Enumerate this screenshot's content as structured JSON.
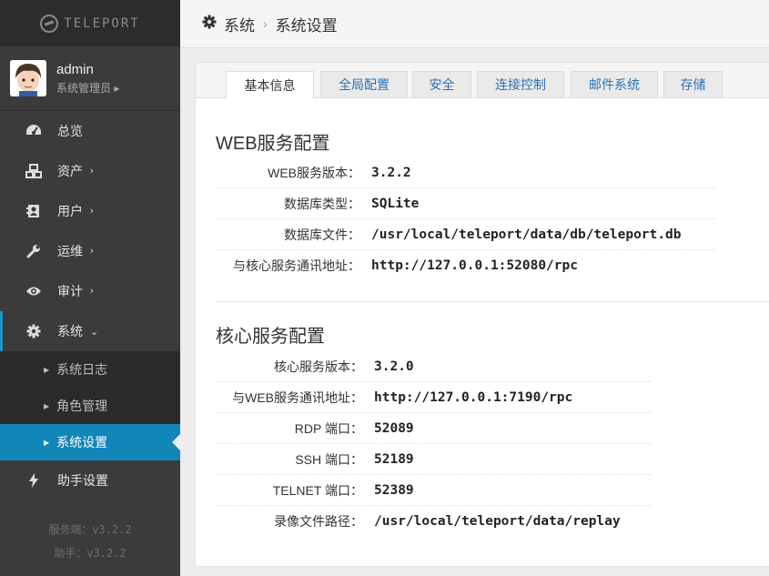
{
  "brand": {
    "name": "TELEPORT"
  },
  "user": {
    "name": "admin",
    "role": "系统管理员 ▸"
  },
  "nav": [
    {
      "label": "总览",
      "icon": "dashboard-icon",
      "chevron": ""
    },
    {
      "label": "资产",
      "icon": "cubes-icon",
      "chevron": "›"
    },
    {
      "label": "用户",
      "icon": "address-card-icon",
      "chevron": "›"
    },
    {
      "label": "运维",
      "icon": "wrench-icon",
      "chevron": "›"
    },
    {
      "label": "审计",
      "icon": "eye-icon",
      "chevron": "›"
    },
    {
      "label": "系统",
      "icon": "gear-icon",
      "chevron": "⌄"
    }
  ],
  "subnav": [
    {
      "label": "系统日志",
      "marker": "▶"
    },
    {
      "label": "角色管理",
      "marker": "▶"
    },
    {
      "label": "系统设置",
      "marker": "▶"
    }
  ],
  "nav_bottom": {
    "label": "助手设置",
    "icon": "bolt-icon"
  },
  "versions": {
    "server": "服务端：v3.2.2",
    "assist": "助手：v3.2.2"
  },
  "breadcrumb": {
    "root": "系统",
    "sep": "›",
    "current": "系统设置"
  },
  "tabs": [
    "基本信息",
    "全局配置",
    "安全",
    "连接控制",
    "邮件系统",
    "存储"
  ],
  "active_tab": 0,
  "web_section": {
    "title": "WEB服务配置",
    "rows": [
      {
        "label": "WEB服务版本：",
        "value": "3.2.2"
      },
      {
        "label": "数据库类型：",
        "value": "SQLite"
      },
      {
        "label": "数据库文件：",
        "value": "/usr/local/teleport/data/db/teleport.db"
      },
      {
        "label": "与核心服务通讯地址：",
        "value": "http://127.0.0.1:52080/rpc"
      }
    ]
  },
  "core_section": {
    "title": "核心服务配置",
    "rows": [
      {
        "label": "核心服务版本：",
        "value": "3.2.0"
      },
      {
        "label": "与WEB服务通讯地址：",
        "value": "http://127.0.0.1:7190/rpc"
      },
      {
        "label": "RDP 端口：",
        "value": "52089"
      },
      {
        "label": "SSH 端口：",
        "value": "52189"
      },
      {
        "label": "TELNET 端口：",
        "value": "52389"
      },
      {
        "label": "录像文件路径：",
        "value": "/usr/local/teleport/data/replay"
      }
    ]
  },
  "colors": {
    "sidebar": "#3b3b3b",
    "active": "#1186b8",
    "link": "#2a72b5"
  }
}
